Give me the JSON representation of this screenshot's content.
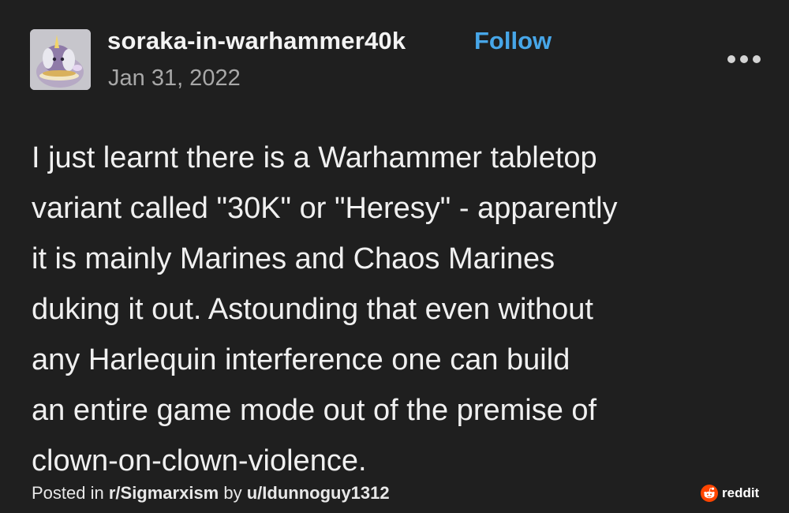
{
  "post": {
    "username": "soraka-in-warhammer40k",
    "follow_label": "Follow",
    "date": "Jan 31, 2022",
    "body_lines": [
      "I just learnt there is a Warhammer tabletop",
      "variant called \"30K\" or \"Heresy\" - apparently",
      "it is mainly Marines and Chaos Marines",
      "duking it out. Astounding that even without",
      "any Harlequin interference one can build",
      "an entire game mode out of the premise of",
      "clown-on-clown-violence."
    ]
  },
  "footer": {
    "posted_in_prefix": "Posted in ",
    "subreddit": "r/Sigmarxism",
    "by_text": " by ",
    "user": "u/Idunnoguy1312",
    "reddit_label": "reddit"
  },
  "icons": {
    "avatar": "soraka-avatar-icon",
    "more": "more-options-icon",
    "reddit": "reddit-logo-icon"
  },
  "colors": {
    "background": "#1f1f1f",
    "follow": "#47a6e8",
    "date": "#a8a8a8",
    "reddit_orange": "#ff4500"
  }
}
